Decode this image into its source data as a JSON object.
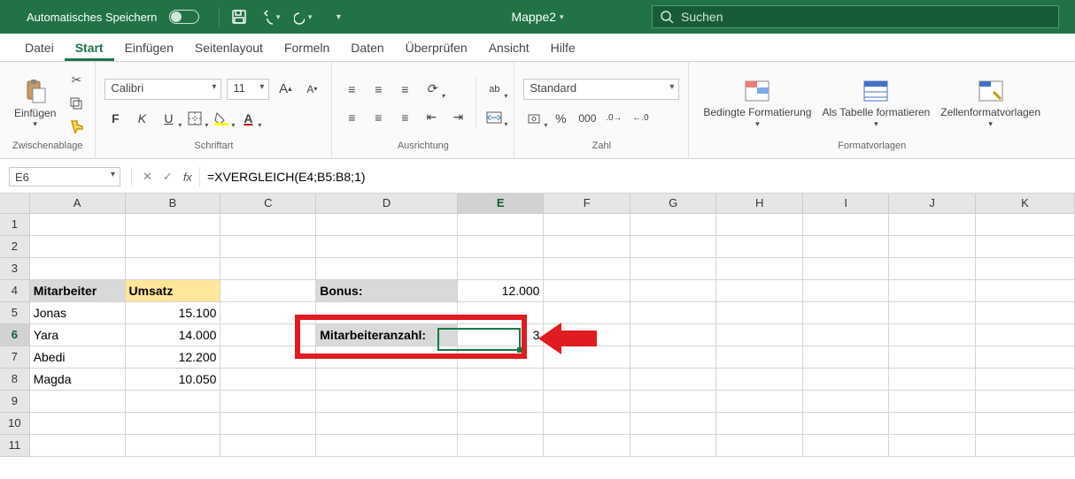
{
  "titleBar": {
    "autoSave": "Automatisches Speichern",
    "docName": "Mappe2",
    "searchPlaceholder": "Suchen"
  },
  "tabs": [
    "Datei",
    "Start",
    "Einfügen",
    "Seitenlayout",
    "Formeln",
    "Daten",
    "Überprüfen",
    "Ansicht",
    "Hilfe"
  ],
  "activeTab": "Start",
  "ribbon": {
    "clipboard": {
      "paste": "Einfügen",
      "group": "Zwischenablage"
    },
    "font": {
      "name": "Calibri",
      "size": "11",
      "bold": "F",
      "italic": "K",
      "underline": "U",
      "group": "Schriftart"
    },
    "alignment": {
      "group": "Ausrichtung"
    },
    "wrap": "ab",
    "number": {
      "format": "Standard",
      "group": "Zahl"
    },
    "styles": {
      "cond": "Bedingte Formatierung",
      "table": "Als Tabelle formatieren",
      "cell": "Zellenformatvorlagen",
      "group": "Formatvorlagen"
    }
  },
  "formulaBar": {
    "cellRef": "E6",
    "formula": "=XVERGLEICH(E4;B5:B8;1)",
    "fx": "fx"
  },
  "columns": [
    "A",
    "B",
    "C",
    "D",
    "E",
    "F",
    "G",
    "H",
    "I",
    "J",
    "K"
  ],
  "activeCol": "E",
  "activeRow": "6",
  "cells": {
    "headers": {
      "mitarbeiter": "Mitarbeiter",
      "umsatz": "Umsatz"
    },
    "bonusLabel": "Bonus:",
    "bonusValue": "12.000",
    "mitarbeiterAnzahlLabel": "Mitarbeiteranzahl:",
    "mitarbeiterAnzahlValue": "3",
    "employees": [
      {
        "name": "Jonas",
        "umsatz": "15.100"
      },
      {
        "name": "Yara",
        "umsatz": "14.000"
      },
      {
        "name": "Abedi",
        "umsatz": "12.200"
      },
      {
        "name": "Magda",
        "umsatz": "10.050"
      }
    ]
  }
}
